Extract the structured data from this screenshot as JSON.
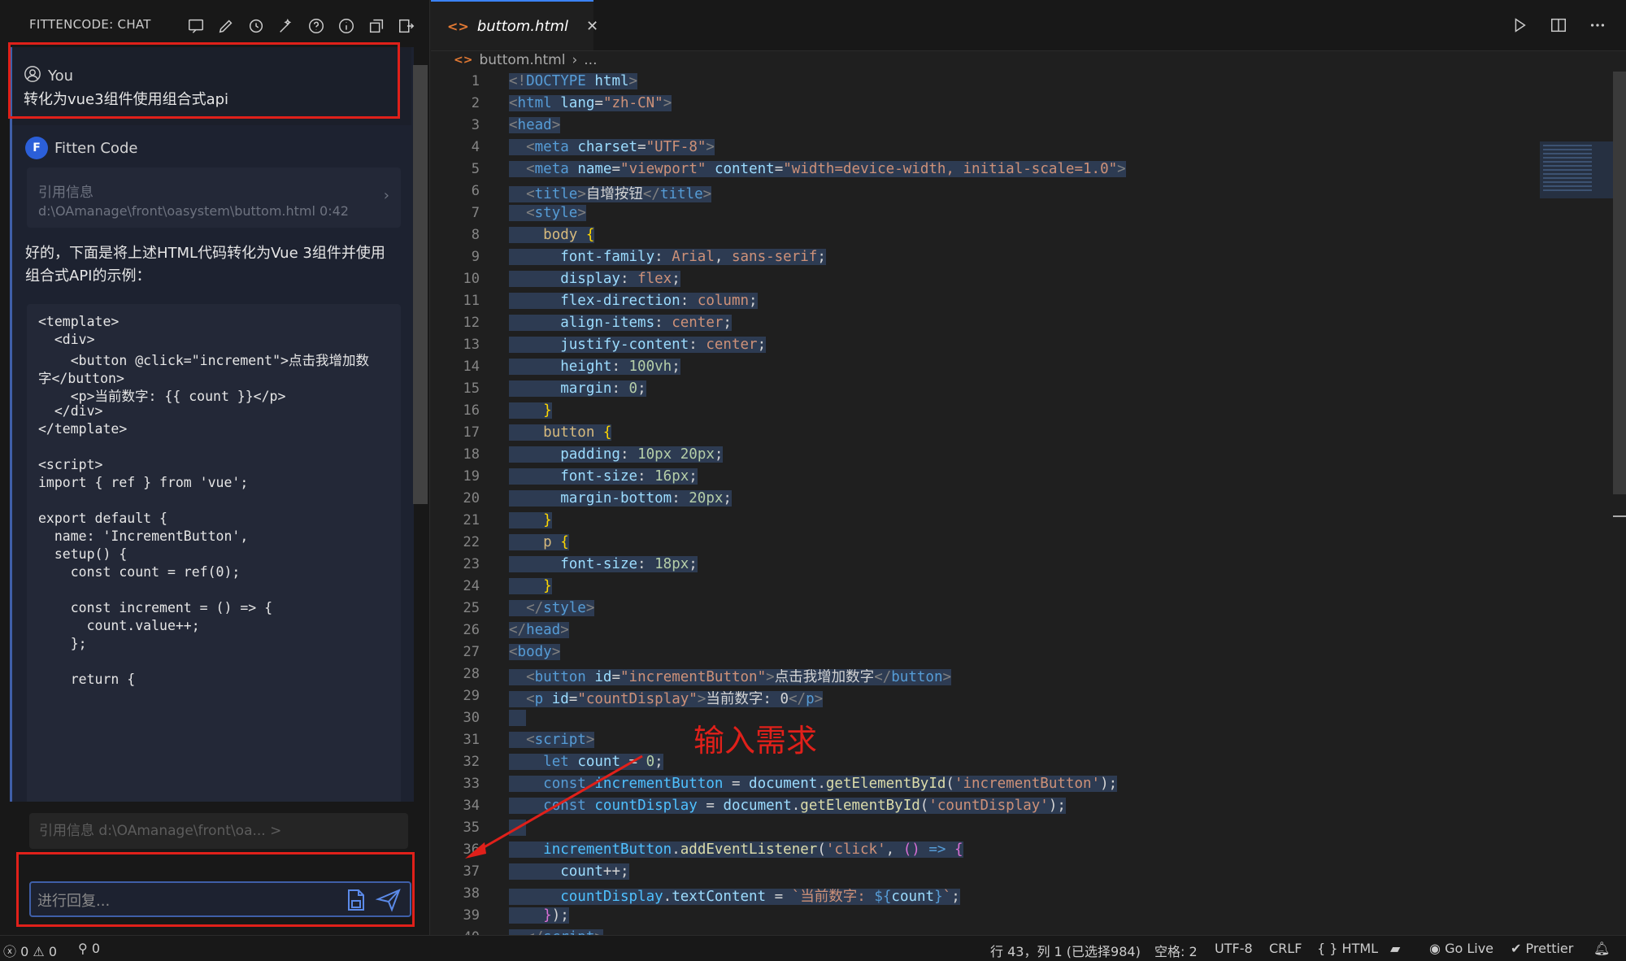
{
  "sidebar": {
    "title": "FITTENCODE: CHAT",
    "user": {
      "name": "You",
      "message": "转化为vue3组件使用组合式api"
    },
    "bot": {
      "name": "Fitten Code",
      "reference": {
        "title": "引用信息",
        "path": "d:\\OAmanage\\front\\oasystem\\buttom.html 0:42"
      },
      "intro_line1": "好的，下面是将上述HTML代码转化为Vue 3组件并使用",
      "intro_line2": "组合式API的示例：",
      "code": [
        "<template>",
        "  <div>",
        "    <button @click=\"increment\">点击我增加数",
        "字</button>",
        "    <p>当前数字: {{ count }}</p>",
        "  </div>",
        "</template>",
        "",
        "<script>",
        "import { ref } from 'vue';",
        "",
        "export default {",
        "  name: 'IncrementButton',",
        "  setup() {",
        "    const count = ref(0);",
        "",
        "    const increment = () => {",
        "      count.value++;",
        "    };",
        "",
        "    return {"
      ]
    },
    "ref_chip": "引用信息 d:\\OAmanage\\front\\oa...  >",
    "input_placeholder": "进行回复..."
  },
  "editor": {
    "tab_label": "buttom.html",
    "breadcrumb_file": "buttom.html",
    "breadcrumb_more": "...",
    "annotation": "输入需求"
  },
  "statusbar": {
    "errors": "0",
    "warnings": "0",
    "ports": "0",
    "position": "行 43，列 1 (已选择984)",
    "spaces": "空格: 2",
    "encoding": "UTF-8",
    "eol": "CRLF",
    "language": "HTML",
    "golive": "Go Live",
    "prettier": "Prettier"
  }
}
